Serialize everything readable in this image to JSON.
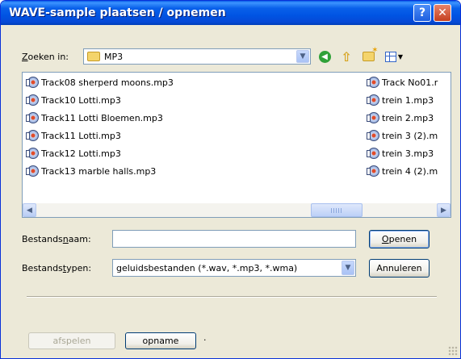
{
  "window": {
    "title": "WAVE-sample plaatsen / opnemen",
    "help_glyph": "?",
    "close_glyph": "✕"
  },
  "lookin": {
    "label_prefix": "Z",
    "label_rest": "oeken in:",
    "folder": "MP3",
    "folder_icon": "folder-icon"
  },
  "toolbar": {
    "back_icon": "back-icon",
    "up_icon": "up-folder-icon",
    "new_folder_icon": "new-folder-icon",
    "views_icon": "views-menu-icon"
  },
  "files": {
    "column1": [
      "Track08 sherperd moons.mp3",
      "Track10 Lotti.mp3",
      "Track11 Lotti Bloemen.mp3",
      "Track11 Lotti.mp3",
      "Track12 Lotti.mp3",
      "Track13 marble halls.mp3"
    ],
    "column2": [
      "Track No01.r",
      "trein 1.mp3",
      "trein 2.mp3",
      "trein 3 (2).m",
      "trein 3.mp3",
      "trein 4 (2).m"
    ]
  },
  "filename": {
    "label_a": "Bestands",
    "label_u": "n",
    "label_b": "aam:",
    "value": ""
  },
  "filetype": {
    "label_a": "Bestands",
    "label_u": "t",
    "label_b": "ypen:",
    "selected": "geluidsbestanden (*.wav, *.mp3, *.wma)"
  },
  "buttons": {
    "open_u": "O",
    "open_rest": "penen",
    "cancel": "Annuleren",
    "play": "afspelen",
    "record": "opname",
    "trailing_dot": "·"
  }
}
